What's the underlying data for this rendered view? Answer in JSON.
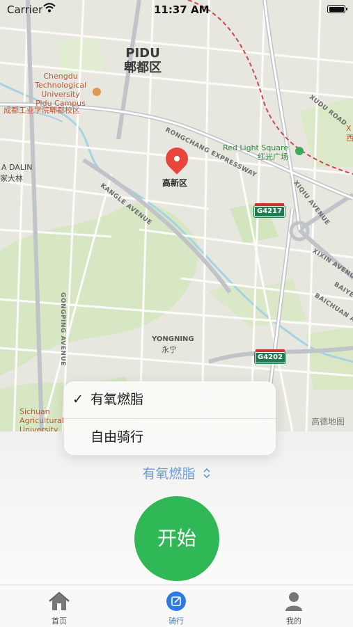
{
  "status_bar": {
    "carrier": "Carrier",
    "time": "11:37 AM"
  },
  "map": {
    "district_en": "PIDU",
    "district_zh": "郫都区",
    "pin_label": "高新区",
    "poi_university": [
      "Chengdu",
      "Technological",
      "University",
      "Pidu Campus",
      "成都工业学院郫都校区"
    ],
    "poi_redlight_en": "Red Light Square",
    "poi_redlight_zh": "红光广场",
    "dalin_en": "A DALIN",
    "dalin_zh": "家大林",
    "road_xudu": "XUDU ROAD",
    "road_rongchang": "RONGCHANG EXPRESSWAY",
    "road_kangle": "KANGLE AVENUE",
    "road_xiqiu": "XIQIU AVENUE",
    "road_xixin": "XIXIN AVENUE",
    "road_baichuan": "BAICHUAN A",
    "road_baiye": "BAIYE",
    "road_gongping": "GONGPING AVENUE",
    "yongning_en": "YONGNING",
    "yongning_zh": "永宁",
    "sichuan": [
      "Sichuan",
      "Agricultural",
      "University"
    ],
    "edge_x": "X",
    "edge_xi": "西",
    "highway_1": "G4217",
    "highway_2": "G4202",
    "watermark": "高德地图",
    "colors": {
      "water": "#9fd3e6",
      "park": "#cfe3b8",
      "road": "#ffffff",
      "major_road": "#b9bcc2",
      "railway": "#d0464a"
    }
  },
  "menu": {
    "items": [
      {
        "label": "有氧燃脂",
        "checked": true,
        "check_glyph": "✓"
      },
      {
        "label": "自由骑行",
        "checked": false
      }
    ]
  },
  "selector": {
    "label": "有氧燃脂",
    "icon": "chevron-up-down-icon"
  },
  "start_button": {
    "label": "开始",
    "color": "#2fb855"
  },
  "tabbar": {
    "tabs": [
      {
        "label": "首页",
        "icon": "home-icon",
        "active": false
      },
      {
        "label": "骑行",
        "icon": "edit-square-icon",
        "active": true
      },
      {
        "label": "我的",
        "icon": "person-icon",
        "active": false
      }
    ],
    "active_color": "#2c7be5"
  }
}
